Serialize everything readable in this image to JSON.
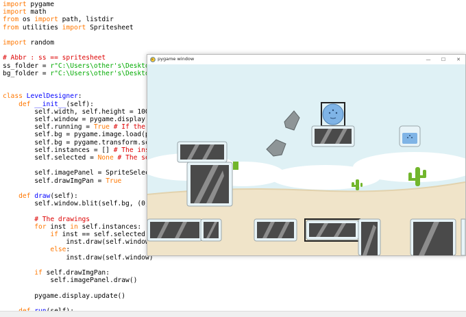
{
  "editor": {
    "lines": [
      [
        [
          "kw",
          "import"
        ],
        [
          "t",
          " pygame"
        ]
      ],
      [
        [
          "kw",
          "import"
        ],
        [
          "t",
          " math"
        ]
      ],
      [
        [
          "kw",
          "from"
        ],
        [
          "t",
          " os "
        ],
        [
          "kw",
          "import"
        ],
        [
          "t",
          " path, listdir"
        ]
      ],
      [
        [
          "kw",
          "from"
        ],
        [
          "t",
          " utilities "
        ],
        [
          "kw",
          "import"
        ],
        [
          "t",
          " Spritesheet"
        ]
      ],
      [],
      [
        [
          "kw",
          "import"
        ],
        [
          "t",
          " random"
        ]
      ],
      [],
      [
        [
          "cm",
          "# Abbr : ss == spritesheet"
        ]
      ],
      [
        [
          "t",
          "ss_folder = "
        ],
        [
          "st",
          "r\"C:\\Users\\other's\\Desktop"
        ]
      ],
      [
        [
          "t",
          "bg_folder = "
        ],
        [
          "st",
          "r\"C:\\Users\\other's\\Desktop"
        ]
      ],
      [],
      [],
      [
        [
          "kw",
          "class"
        ],
        [
          "t",
          " "
        ],
        [
          "df",
          "LevelDesigner"
        ],
        [
          "t",
          ":"
        ]
      ],
      [
        [
          "t",
          "    "
        ],
        [
          "kw",
          "def"
        ],
        [
          "t",
          " "
        ],
        [
          "df",
          "__init__"
        ],
        [
          "t",
          "(self):"
        ]
      ],
      [
        [
          "t",
          "        self.width, self.height = 1000"
        ]
      ],
      [
        [
          "t",
          "        self.window = pygame.display.s"
        ]
      ],
      [
        [
          "t",
          "        self.running = "
        ],
        [
          "kw",
          "True"
        ],
        [
          "t",
          " "
        ],
        [
          "cm",
          "# If the p"
        ]
      ],
      [
        [
          "t",
          "        self.bg = pygame.image.load(pa"
        ]
      ],
      [
        [
          "t",
          "        self.bg = pygame.transform.sca"
        ]
      ],
      [
        [
          "t",
          "        self.instances = [] "
        ],
        [
          "cm",
          "# The inst"
        ]
      ],
      [
        [
          "t",
          "        self.selected = "
        ],
        [
          "kw",
          "None"
        ],
        [
          "t",
          " "
        ],
        [
          "cm",
          "# The sel"
        ]
      ],
      [],
      [
        [
          "t",
          "        self.imagePanel = SpriteSelect"
        ]
      ],
      [
        [
          "t",
          "        self.drawImgPan = "
        ],
        [
          "kw",
          "True"
        ]
      ],
      [],
      [
        [
          "t",
          "    "
        ],
        [
          "kw",
          "def"
        ],
        [
          "t",
          " "
        ],
        [
          "df",
          "draw"
        ],
        [
          "t",
          "(self):"
        ]
      ],
      [
        [
          "t",
          "        self.window.blit(self.bg, (0,"
        ]
      ],
      [],
      [
        [
          "t",
          "        "
        ],
        [
          "cm",
          "# The drawings"
        ]
      ],
      [
        [
          "t",
          "        "
        ],
        [
          "kw",
          "for"
        ],
        [
          "t",
          " inst "
        ],
        [
          "kw",
          "in"
        ],
        [
          "t",
          " self.instances:"
        ]
      ],
      [
        [
          "t",
          "            "
        ],
        [
          "kw",
          "if"
        ],
        [
          "t",
          " inst == self.selected:"
        ]
      ],
      [
        [
          "t",
          "                inst.draw(self.window,"
        ]
      ],
      [
        [
          "t",
          "            "
        ],
        [
          "kw",
          "else"
        ],
        [
          "t",
          ":"
        ]
      ],
      [
        [
          "t",
          "                inst.draw(self.window)"
        ]
      ],
      [],
      [
        [
          "t",
          "        "
        ],
        [
          "kw",
          "if"
        ],
        [
          "t",
          " self.drawImgPan:"
        ]
      ],
      [
        [
          "t",
          "            self.imagePanel.draw()"
        ]
      ],
      [],
      [
        [
          "t",
          "        pygame.display.update()"
        ]
      ],
      [],
      [
        [
          "t",
          "    "
        ],
        [
          "kw",
          "def"
        ],
        [
          "t",
          " "
        ],
        [
          "df",
          "run"
        ],
        [
          "t",
          "(self):"
        ]
      ]
    ]
  },
  "window": {
    "title": "pygame window",
    "minimize_glyph": "—",
    "maximize_glyph": "☐",
    "close_glyph": "✕",
    "icon": "pygame-snake-icon"
  },
  "colors": {
    "sky": "#dff1f5",
    "sand": "#f0e4c9",
    "block_fill": "#4a4a4a",
    "block_frame": "#e8f4f8",
    "cactus": "#72b62c",
    "blob": "#7fb4e6"
  }
}
